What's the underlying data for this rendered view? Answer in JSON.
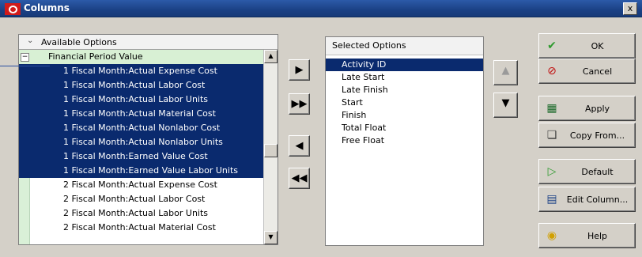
{
  "window": {
    "title": "Columns",
    "close_label": "x"
  },
  "available": {
    "header": "Available Options",
    "category": "Financial Period Value",
    "items": [
      {
        "label": "1 Fiscal Month:Actual Expense Cost",
        "selected": true
      },
      {
        "label": "1 Fiscal Month:Actual Labor Cost",
        "selected": true
      },
      {
        "label": "1 Fiscal Month:Actual Labor Units",
        "selected": true
      },
      {
        "label": "1 Fiscal Month:Actual Material Cost",
        "selected": true
      },
      {
        "label": "1 Fiscal Month:Actual Nonlabor Cost",
        "selected": true
      },
      {
        "label": "1 Fiscal Month:Actual Nonlabor Units",
        "selected": true
      },
      {
        "label": "1 Fiscal Month:Earned Value Cost",
        "selected": true
      },
      {
        "label": "1 Fiscal Month:Earned Value Labor Units",
        "selected": true
      },
      {
        "label": "2 Fiscal Month:Actual Expense Cost",
        "selected": false
      },
      {
        "label": "2 Fiscal Month:Actual Labor Cost",
        "selected": false
      },
      {
        "label": "2 Fiscal Month:Actual Labor Units",
        "selected": false
      },
      {
        "label": "2 Fiscal Month:Actual Material Cost",
        "selected": false
      }
    ]
  },
  "selected": {
    "header": "Selected Options",
    "items": [
      "Activity ID",
      "Late Start",
      "Late Finish",
      "Start",
      "Finish",
      "Total Float",
      "Free Float"
    ],
    "active_index": 0
  },
  "buttons": {
    "ok": "OK",
    "cancel": "Cancel",
    "apply": "Apply",
    "copy_from": "Copy From...",
    "default": "Default",
    "edit_column": "Edit Column...",
    "help": "Help"
  },
  "colors": {
    "selection": "#0a2a6e",
    "category_bg": "#d8f0d4",
    "title_bar": "#1b4185"
  }
}
